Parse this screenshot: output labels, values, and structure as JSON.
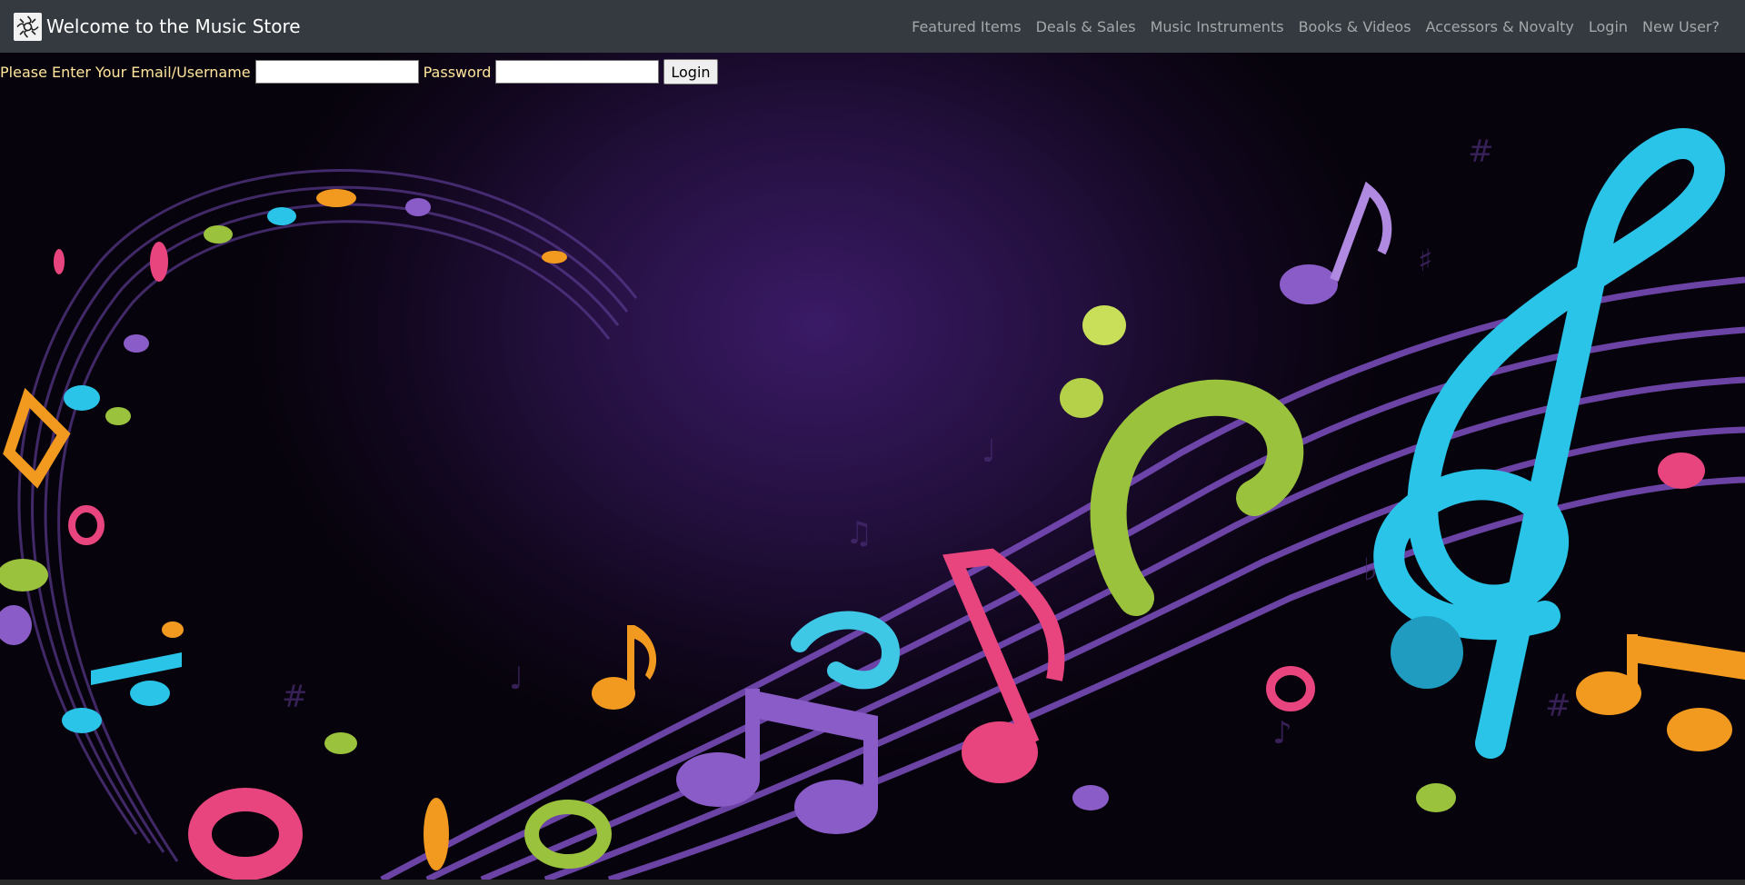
{
  "brand": {
    "title": "Welcome to the Music Store",
    "logo_icon": "ornament-logo-icon"
  },
  "nav": {
    "items": [
      {
        "label": "Featured Items"
      },
      {
        "label": "Deals & Sales"
      },
      {
        "label": "Music Instruments"
      },
      {
        "label": "Books & Videos"
      },
      {
        "label": "Accessors & Novalty"
      },
      {
        "label": "Login"
      },
      {
        "label": "New User?"
      }
    ]
  },
  "login_form": {
    "email_label": "Please Enter Your Email/Username",
    "email_value": "",
    "password_label": "Password",
    "password_value": "",
    "submit_label": "Login"
  },
  "hero": {
    "image": "colorful-music-notes-background",
    "colors": {
      "background": "#24103f",
      "cyan": "#29c4e8",
      "green": "#9ac23c",
      "pink": "#e8457f",
      "purple": "#8a5cc8",
      "orange": "#f29a1f"
    }
  },
  "theme": {
    "navbar_bg": "#343a40",
    "label_color": "#ffe69c"
  }
}
